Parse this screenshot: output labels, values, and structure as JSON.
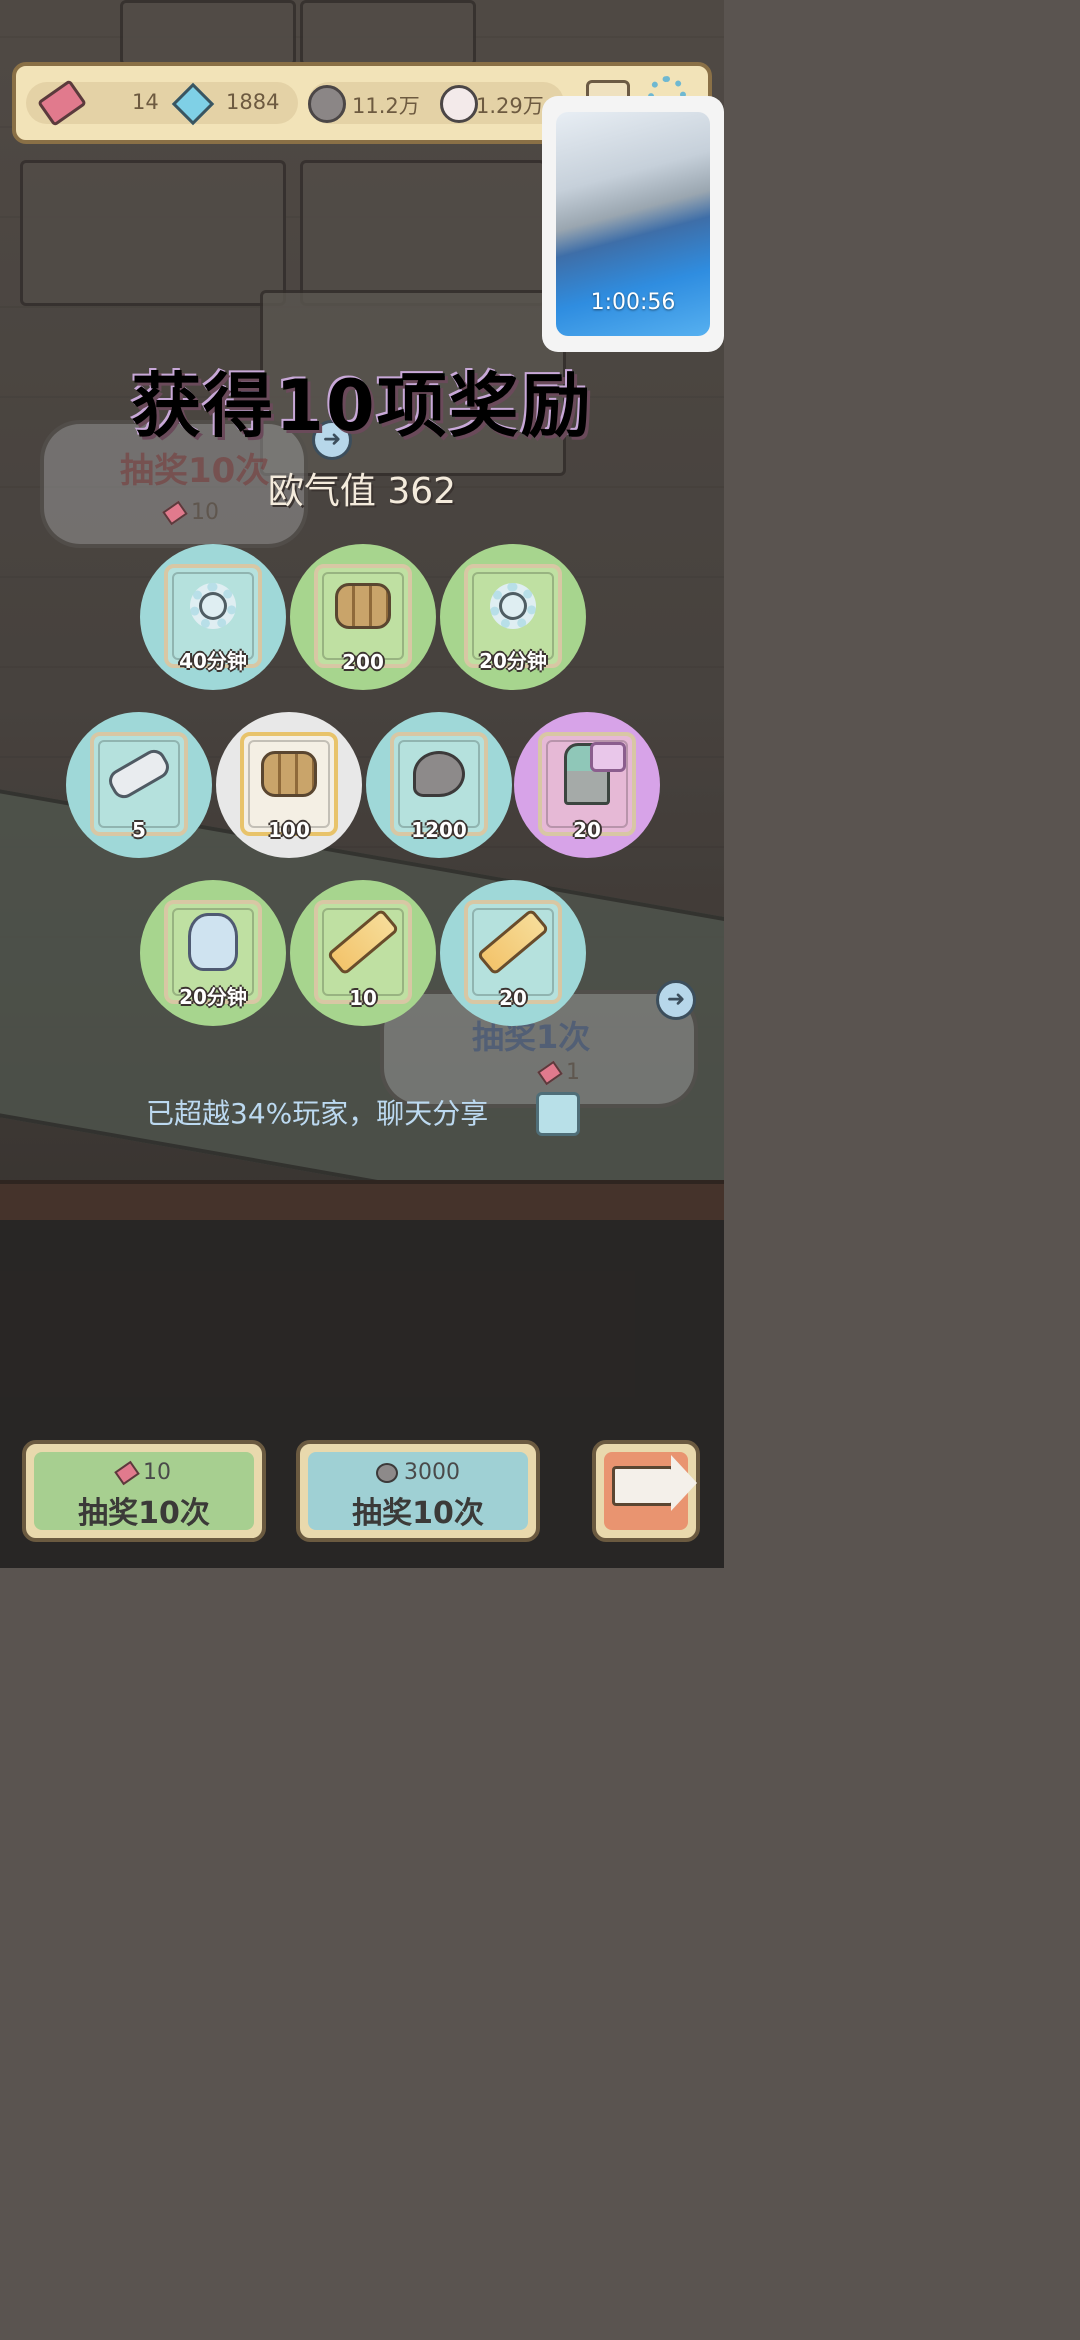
{
  "topbar": {
    "tickets": "14",
    "crystals": "1884",
    "ghost_currency": "11.2万",
    "pink_currency": "1.29万"
  },
  "pip": {
    "timer": "1:00:56"
  },
  "result": {
    "title": "获得10项奖励",
    "luck_label": "欧气值 362"
  },
  "background_signs": {
    "left_label": "抽奖10次",
    "left_cost": "10",
    "right_label": "抽奖1次",
    "right_cost": "1"
  },
  "rewards": [
    {
      "item": "gear",
      "qty": "40分钟",
      "rarity": "teal"
    },
    {
      "item": "logs",
      "qty": "200",
      "rarity": "green"
    },
    {
      "item": "gear",
      "qty": "20分钟",
      "rarity": "green"
    },
    {
      "item": "scroll",
      "qty": "5",
      "rarity": "teal"
    },
    {
      "item": "logs",
      "qty": "100",
      "rarity": "white"
    },
    {
      "item": "blob",
      "qty": "1200",
      "rarity": "teal"
    },
    {
      "item": "statue",
      "qty": "20",
      "rarity": "purple"
    },
    {
      "item": "snail",
      "qty": "20分钟",
      "rarity": "green"
    },
    {
      "item": "tube",
      "qty": "10",
      "rarity": "green"
    },
    {
      "item": "tube",
      "qty": "20",
      "rarity": "teal"
    }
  ],
  "share": {
    "text": "已超越34%玩家，聊天分享"
  },
  "buttons": {
    "draw_ticket": {
      "cost": "10",
      "label": "抽奖10次"
    },
    "draw_currency": {
      "cost": "3000",
      "label": "抽奖10次"
    }
  },
  "colors": {
    "teal": "#9fd8d8",
    "green": "#a7d58e",
    "white": "#e8e8e8",
    "purple": "#d7a3e8"
  }
}
